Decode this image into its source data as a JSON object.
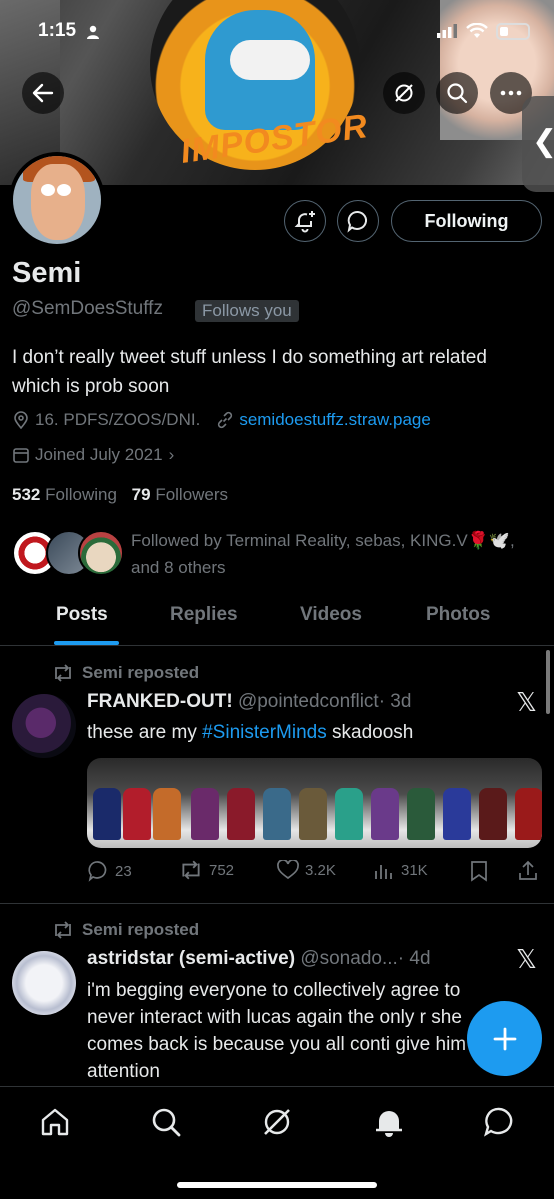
{
  "status_bar": {
    "time": "1:15"
  },
  "profile": {
    "name": "Semi",
    "handle": "@SemDoesStuffz",
    "follows_you_badge": "Follows you",
    "follow_button_label": "Following",
    "bio": "I don’t really tweet stuff unless I do something art related which is prob soon",
    "location": "16. PDFS/ZOOS/DNI.",
    "website": "semidoestuffz.straw.page",
    "joined": "Joined July 2021",
    "following_count": "532",
    "following_label": "Following",
    "followers_count": "79",
    "followers_label": "Followers",
    "followed_by": "Followed by Terminal Reality, sebas, KING.V🌹🕊️, and 8 others"
  },
  "tabs": [
    {
      "label": "Posts",
      "active": true
    },
    {
      "label": "Replies",
      "active": false
    },
    {
      "label": "Videos",
      "active": false
    },
    {
      "label": "Photos",
      "active": false
    }
  ],
  "posts": [
    {
      "repost_label": "Semi reposted",
      "author": "FRANKED-OUT!",
      "handle": "@pointedconflict",
      "time": "· 3d",
      "text_before": "these are my ",
      "hashtag": "#SinisterMinds",
      "text_after": " skadoosh",
      "replies": "23",
      "reposts": "752",
      "likes": "3.2K",
      "views": "31K"
    },
    {
      "repost_label": "Semi reposted",
      "author": "astridstar (semi-active)",
      "handle": "@sonado...",
      "time": "· 4d",
      "text": "i'm begging everyone to collectively agree to never interact with lucas again the only r she comes back is because you all conti give him attention"
    }
  ],
  "colors": {
    "accent": "#1d9bf0",
    "background": "#000000",
    "muted": "#71767b",
    "text": "#e7e9ea",
    "border": "#2f3336"
  },
  "icons": {
    "banner": [
      "back-arrow-icon",
      "no-grok-icon",
      "search-icon",
      "more-icon",
      "chevron-left-icon"
    ],
    "actions": [
      "bell-plus-icon",
      "message-icon"
    ],
    "bottom_nav": [
      "home-icon",
      "search-icon",
      "grok-icon",
      "notifications-icon",
      "messages-icon"
    ]
  }
}
